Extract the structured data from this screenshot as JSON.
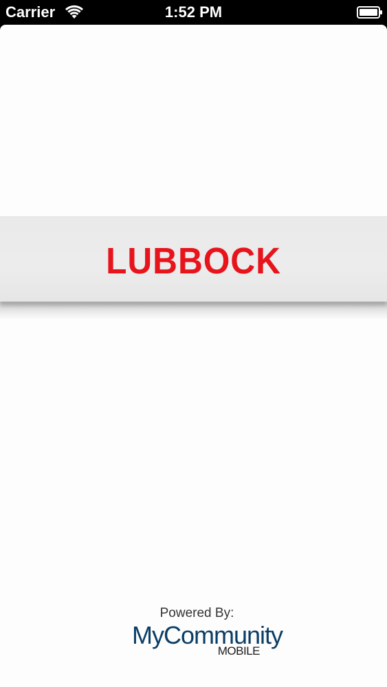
{
  "status_bar": {
    "carrier": "Carrier",
    "time": "1:52 PM",
    "wifi_icon": "wifi-icon",
    "battery_icon": "battery-icon"
  },
  "splash": {
    "city_name": "LUBBOCK",
    "accent_color": "#e8141c"
  },
  "footer": {
    "powered_by": "Powered By:",
    "brand_name": "MyCommunity",
    "brand_sub": "MOBILE",
    "brand_color": "#0b3d66"
  }
}
